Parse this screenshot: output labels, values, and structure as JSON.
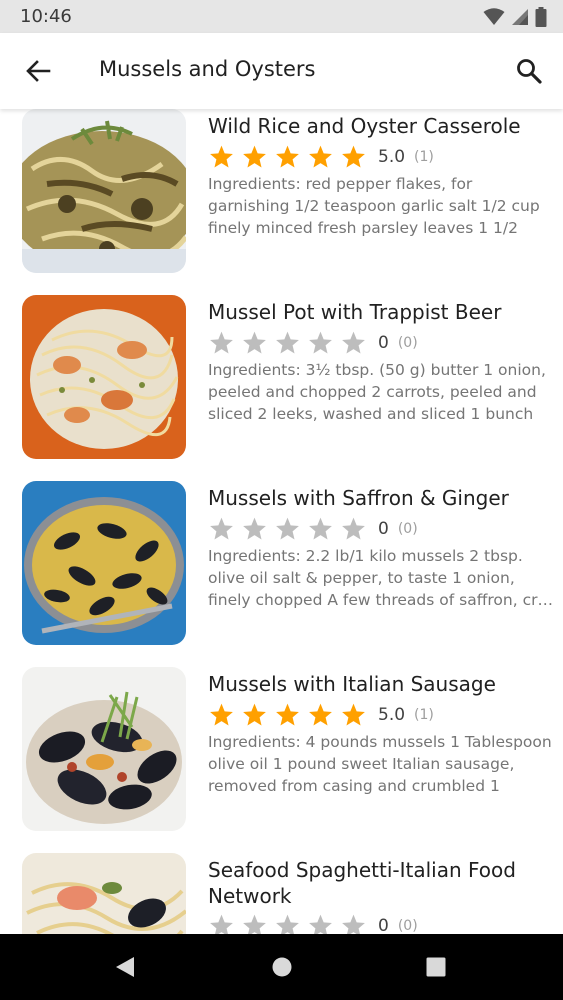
{
  "status_bar": {
    "time": "10:46",
    "icons": [
      "wifi-icon",
      "signal-icon",
      "battery-icon"
    ]
  },
  "app_bar": {
    "title": "Mussels and Oysters",
    "back_icon": "arrow-left-icon",
    "search_icon": "search-icon"
  },
  "colors": {
    "star_filled": "#FFA000",
    "star_empty": "#BDBDBD",
    "nav_bar": "#000000",
    "status_bar": "#E6E6E6"
  },
  "recipes": [
    {
      "title": "Wild Rice and Oyster Casserole",
      "rating_value": "5.0",
      "rating_count": "(1)",
      "stars_filled": 5,
      "ingredients": "Ingredients: red pepper flakes, for garnishing 1/2 teaspoon garlic salt 1/2 cup finely minced fresh parsley leaves 1 1/2 teaspoo…",
      "image": "wild-rice-oyster-casserole-photo"
    },
    {
      "title": "Mussel Pot with Trappist Beer",
      "rating_value": "0",
      "rating_count": "(0)",
      "stars_filled": 0,
      "ingredients": "Ingredients: 3½ tbsp. (50 g) butter 1 onion, peeled and chopped 2 carrots, peeled and sliced 2 leeks, washed and sliced 1 bunch (…",
      "image": "mussel-pot-photo"
    },
    {
      "title": "Mussels with Saffron & Ginger",
      "rating_value": "0",
      "rating_count": "(0)",
      "stars_filled": 0,
      "ingredients": "Ingredients: 2.2 lb/1 kilo mussels 2 tbsp. olive oil salt & pepper, to taste 1 onion, finely chopped A few threads of saffron, cr…",
      "image": "mussels-saffron-ginger-photo"
    },
    {
      "title": "Mussels with Italian Sausage",
      "rating_value": "5.0",
      "rating_count": "(1)",
      "stars_filled": 5,
      "ingredients": "Ingredients: 4 pounds mussels 1 Tablespoon olive oil 1 pound sweet Italian sausage, removed from casing and crumbled 1 smal…",
      "image": "mussels-italian-sausage-photo"
    },
    {
      "title": "Seafood Spaghetti-Italian Food Network",
      "rating_value": "0",
      "rating_count": "(0)",
      "stars_filled": 0,
      "ingredients": "",
      "image": "seafood-spaghetti-photo"
    }
  ],
  "nav_bar": {
    "back": "nav-back-icon",
    "home": "nav-home-icon",
    "recents": "nav-recents-icon"
  }
}
